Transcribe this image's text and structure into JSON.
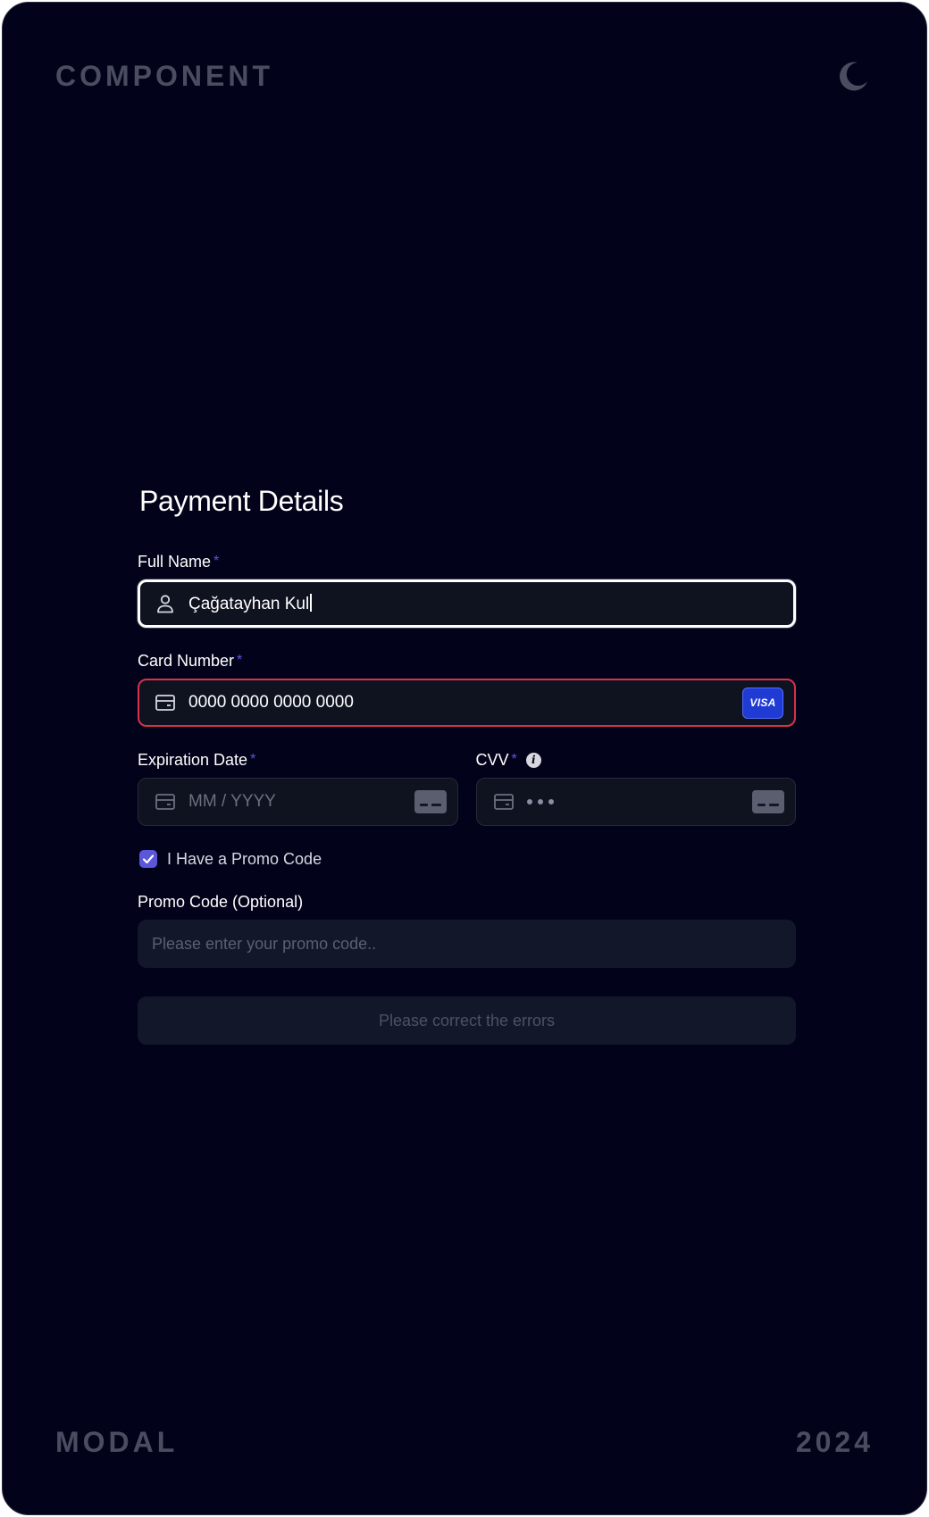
{
  "corner_labels": {
    "top_left": "COMPONENT",
    "bottom_left": "MODAL",
    "bottom_right": "2024"
  },
  "theme_toggle_icon": "moon-icon",
  "form": {
    "title": "Payment Details",
    "required_mark": "*",
    "full_name": {
      "label": "Full Name",
      "value": "Çağatayhan Kul",
      "icon": "user-icon",
      "state": "focused"
    },
    "card_number": {
      "label": "Card Number",
      "value": "0000 0000 0000 0000",
      "icon": "credit-card-icon",
      "brand": "VISA",
      "state": "error"
    },
    "expiration_date": {
      "label": "Expiration Date",
      "placeholder": "MM / YYYY",
      "icon": "credit-card-icon"
    },
    "cvv": {
      "label": "CVV",
      "info_icon": "info-icon",
      "masked_length": 3
    },
    "promo_checkbox": {
      "label": "I Have a Promo Code",
      "checked": true
    },
    "promo_code": {
      "label": "Promo Code (Optional)",
      "placeholder": "Please enter your promo code.."
    },
    "submit": {
      "label": "Please correct the errors",
      "disabled": true
    }
  },
  "colors": {
    "background": "#02031a",
    "accent": "#5b57d9",
    "error": "#d8314a",
    "visa_blue": "#1f3bd4"
  }
}
